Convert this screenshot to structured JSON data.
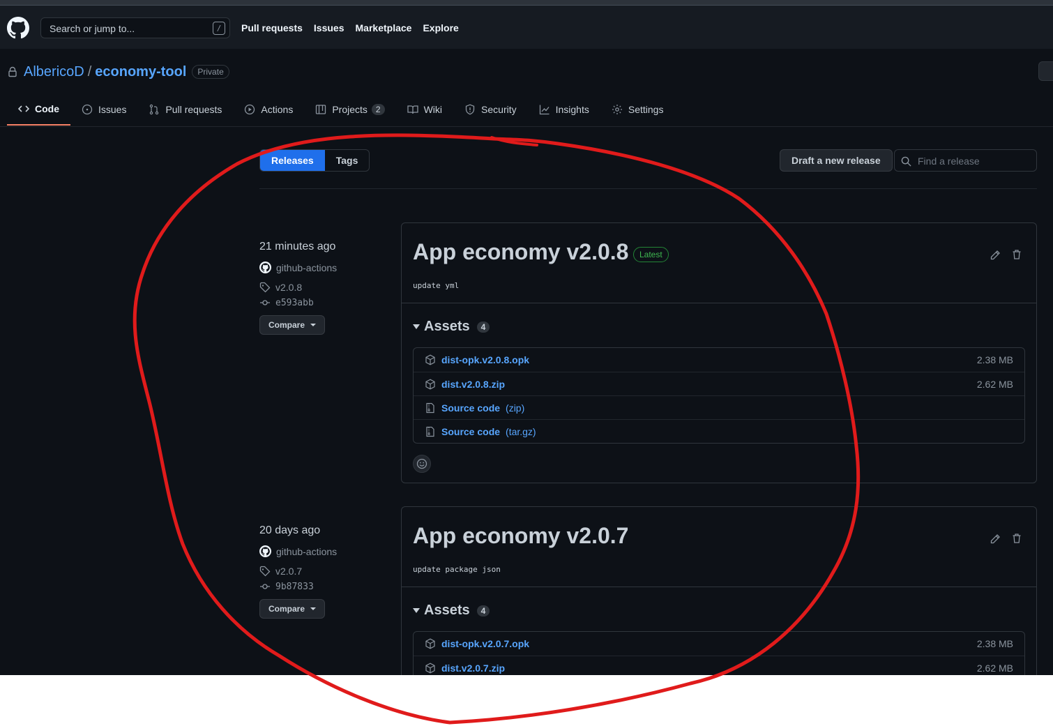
{
  "header": {
    "search_placeholder": "Search or jump to...",
    "search_shortcut": "/",
    "nav": [
      "Pull requests",
      "Issues",
      "Marketplace",
      "Explore"
    ]
  },
  "repo": {
    "owner": "AlbericoD",
    "separator": "/",
    "name": "economy-tool",
    "visibility": "Private"
  },
  "tabs": [
    {
      "label": "Code",
      "icon": "code-icon",
      "active": true
    },
    {
      "label": "Issues",
      "icon": "issue-opened-icon"
    },
    {
      "label": "Pull requests",
      "icon": "git-pull-request-icon"
    },
    {
      "label": "Actions",
      "icon": "play-icon"
    },
    {
      "label": "Projects",
      "icon": "table-icon",
      "count": "2"
    },
    {
      "label": "Wiki",
      "icon": "book-icon"
    },
    {
      "label": "Security",
      "icon": "shield-icon"
    },
    {
      "label": "Insights",
      "icon": "graph-icon"
    },
    {
      "label": "Settings",
      "icon": "gear-icon"
    }
  ],
  "toolbar": {
    "releases_label": "Releases",
    "tags_label": "Tags",
    "draft_label": "Draft a new release",
    "find_placeholder": "Find a release"
  },
  "releases": [
    {
      "time": "21 minutes ago",
      "author": "github-actions",
      "tag": "v2.0.8",
      "commit": "e593abb",
      "compare_label": "Compare",
      "title": "App economy v2.0.8",
      "latest_label": "Latest",
      "note": "update yml",
      "assets_label": "Assets",
      "assets_count": "4",
      "assets": [
        {
          "name": "dist-opk.v2.0.8.opk",
          "size": "2.38 MB",
          "icon": "package-icon"
        },
        {
          "name": "dist.v2.0.8.zip",
          "size": "2.62 MB",
          "icon": "package-icon"
        },
        {
          "name": "Source code",
          "format": "(zip)",
          "icon": "file-zip-icon"
        },
        {
          "name": "Source code",
          "format": "(tar.gz)",
          "icon": "file-zip-icon"
        }
      ]
    },
    {
      "time": "20 days ago",
      "author": "github-actions",
      "tag": "v2.0.7",
      "commit": "9b87833",
      "compare_label": "Compare",
      "title": "App economy v2.0.7",
      "note": "update package json",
      "assets_label": "Assets",
      "assets_count": "4",
      "assets": [
        {
          "name": "dist-opk.v2.0.7.opk",
          "size": "2.38 MB",
          "icon": "package-icon"
        },
        {
          "name": "dist.v2.0.7.zip",
          "size": "2.62 MB",
          "icon": "package-icon"
        }
      ]
    }
  ],
  "colors": {
    "background": "#0d1117",
    "header": "#161b22",
    "link": "#58a6ff",
    "accent_tab": "#f78166",
    "primary_button": "#1f6feb",
    "latest_green": "#3fb950",
    "annotation_red": "#e01b1b"
  }
}
